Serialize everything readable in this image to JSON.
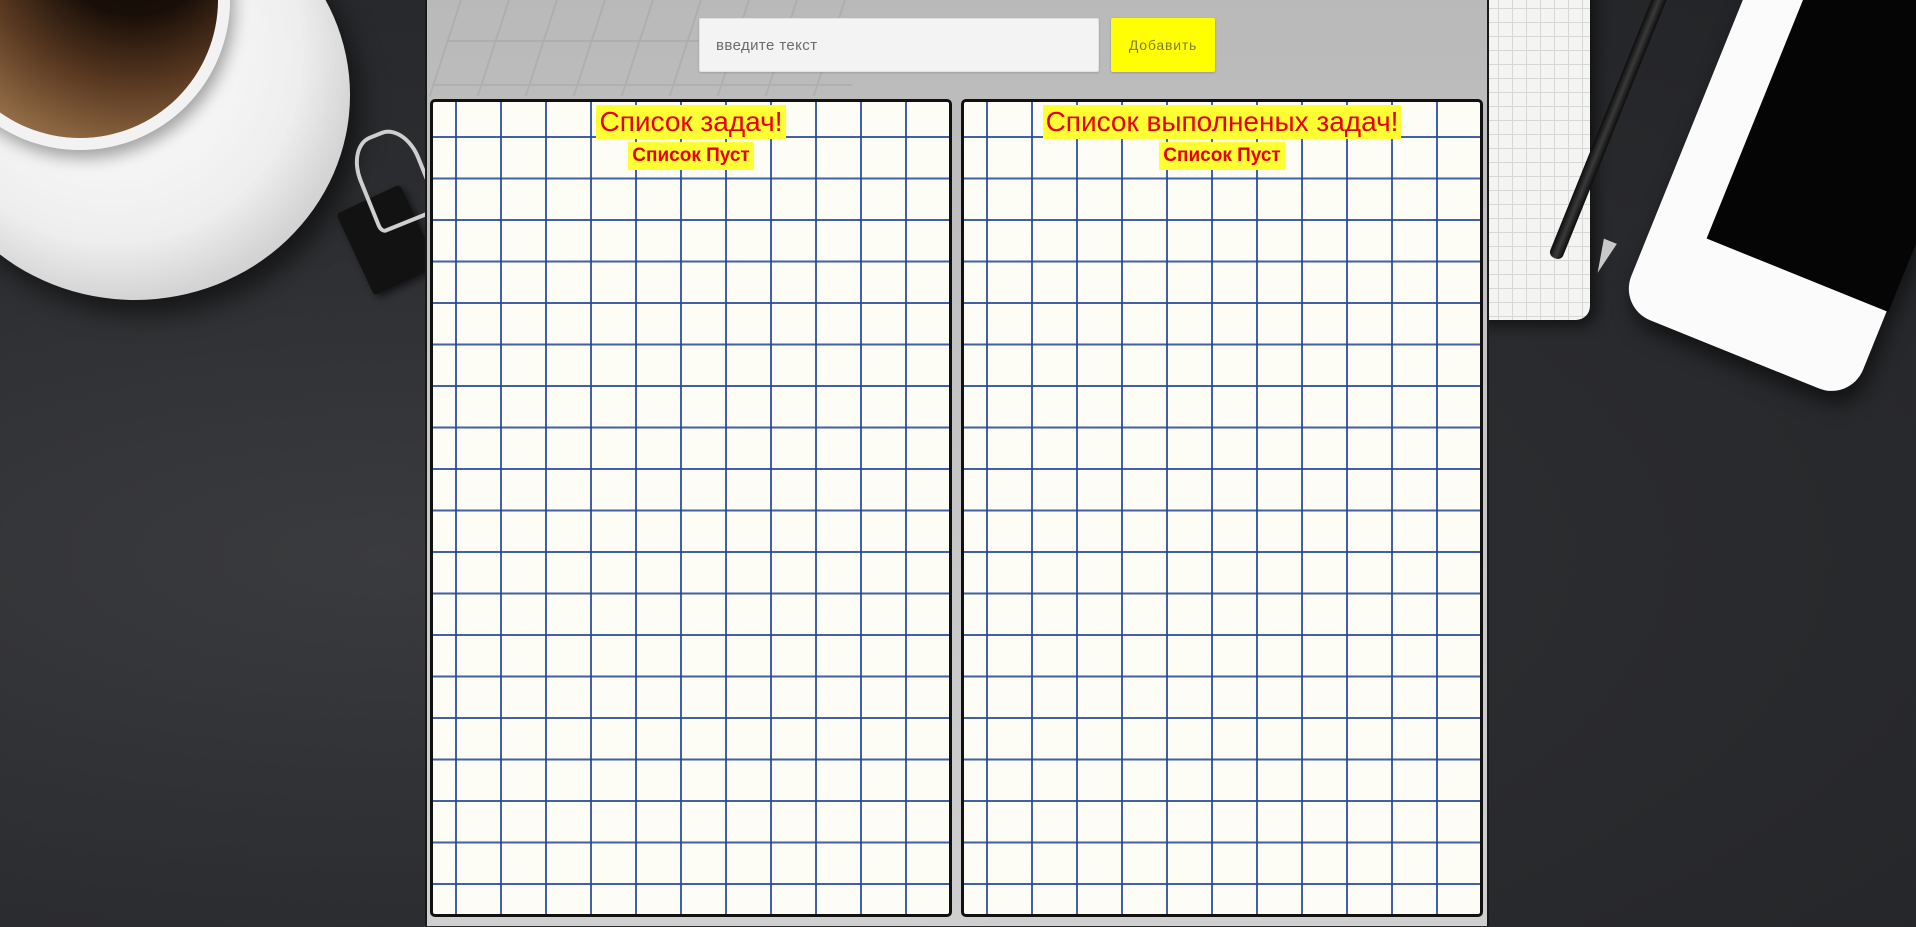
{
  "form": {
    "input_placeholder": "введите текст",
    "input_value": "",
    "add_button_label": "Добавить"
  },
  "todo_panel": {
    "title": "Список задач!",
    "empty_text": "Список Пуст"
  },
  "done_panel": {
    "title": "Список выполненых задач!",
    "empty_text": "Список Пуст"
  },
  "colors": {
    "label_background": "#ffff33",
    "label_text": "#e6000f",
    "button_background": "#ffff00",
    "grid_line": "#1e4696"
  }
}
